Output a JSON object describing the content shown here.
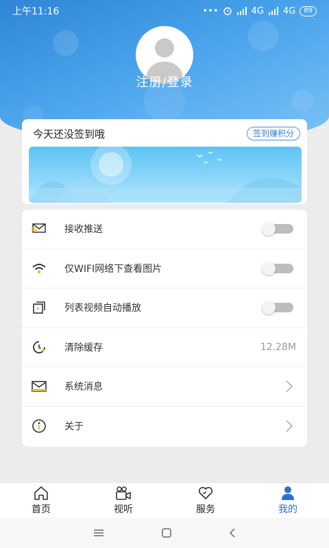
{
  "status_bar": {
    "time": "上午11:16",
    "dots": "•••",
    "signal_1": "4G",
    "signal_2": "4G",
    "battery": "89"
  },
  "profile": {
    "login_label": "注册/登录"
  },
  "signin": {
    "text": "今天还没签到哦",
    "button_label": "签到赚积分"
  },
  "settings": {
    "items": [
      {
        "label": "接收推送",
        "type": "toggle",
        "icon": "push-icon"
      },
      {
        "label": "仅WIFI网络下查看图片",
        "type": "toggle",
        "icon": "wifi-icon"
      },
      {
        "label": "列表视频自动播放",
        "type": "toggle",
        "icon": "video-autoplay-icon"
      },
      {
        "label": "清除缓存",
        "type": "value",
        "value": "12.28M",
        "icon": "clear-cache-icon"
      },
      {
        "label": "系统消息",
        "type": "link",
        "icon": "mail-icon"
      },
      {
        "label": "关于",
        "type": "link",
        "icon": "info-icon"
      }
    ]
  },
  "tabs": [
    {
      "label": "首页",
      "icon": "home-icon",
      "active": false
    },
    {
      "label": "视听",
      "icon": "video-camera-icon",
      "active": false
    },
    {
      "label": "服务",
      "icon": "heart-icon",
      "active": false
    },
    {
      "label": "我的",
      "icon": "user-icon",
      "active": true
    }
  ],
  "colors": {
    "accent": "#2f6fd8",
    "header_blue": "#3a93e0",
    "icon_yellow": "#f2b632"
  }
}
